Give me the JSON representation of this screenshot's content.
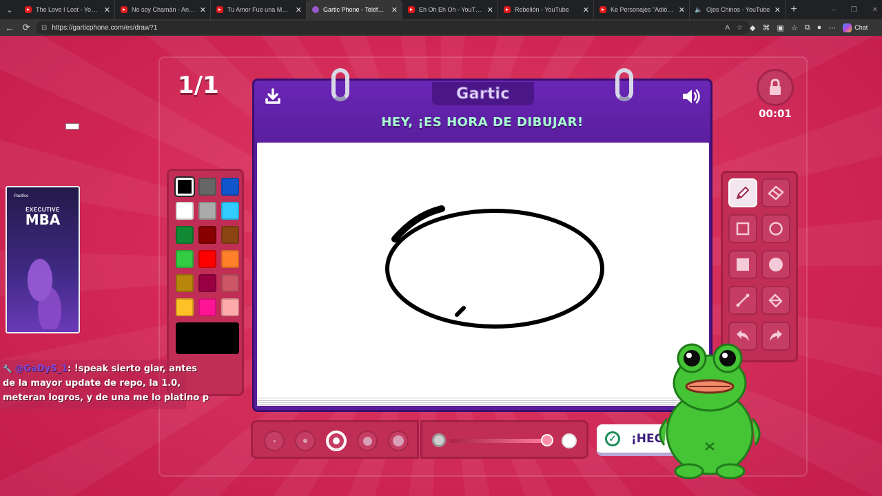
{
  "browser": {
    "tabs": [
      {
        "title": "The Love I Lost - YouTube",
        "icon": "youtube-icon",
        "active": false
      },
      {
        "title": "No soy Chamán - Anticucho",
        "icon": "youtube-icon",
        "active": false
      },
      {
        "title": "Tu Amor Fue una Mentira -",
        "icon": "youtube-icon",
        "active": false
      },
      {
        "title": "Gartic Phone - Teléfono Des",
        "icon": "gartic-icon",
        "active": true
      },
      {
        "title": "Eh Oh Eh Oh - YouTube",
        "icon": "youtube-icon",
        "active": false
      },
      {
        "title": "Rebelión - YouTube",
        "icon": "youtube-icon",
        "active": false
      },
      {
        "title": "Ke Personajes \"Adiós Amor #",
        "icon": "youtube-icon",
        "active": false
      },
      {
        "title": "Ojos Chinos - YouTube",
        "icon": "speaker-icon",
        "active": false
      }
    ],
    "url": "https://garticphone.com/es/draw?1",
    "chat_label": "Chat"
  },
  "game": {
    "round": "1/1",
    "logo": "Gartic",
    "prompt": "HEY, ¡ES HORA DE DIBUJAR!",
    "timer": "00:01",
    "done_label": "¡HEC",
    "palette": [
      "#000000",
      "#666666",
      "#1155cc",
      "#ffffff",
      "#aaaaaa",
      "#33ccff",
      "#118833",
      "#880000",
      "#8b4513",
      "#33cc44",
      "#ff0000",
      "#ff7f2a",
      "#b8860b",
      "#990044",
      "#cc5566",
      "#ffc125",
      "#ff1493",
      "#ffaaaa"
    ],
    "selected_color": "#000000",
    "tools": [
      "pencil-icon",
      "eraser-icon",
      "rectangle-outline-icon",
      "ellipse-outline-icon",
      "rectangle-filled-icon",
      "ellipse-filled-icon",
      "line-icon",
      "fill-bucket-icon",
      "undo-icon",
      "redo-icon"
    ],
    "selected_tool": "pencil-icon",
    "brush_sizes": [
      1,
      2,
      3,
      4,
      5
    ],
    "selected_brush_size": 3
  },
  "overlays": {
    "ad": {
      "brand": "Pacífico",
      "line1": "EXECUTIVE",
      "line2": "MBA"
    },
    "chat": {
      "user": "@GaDyS_1",
      "line1": ": !speak sierto giar, antes",
      "line2": "de la mayor update de repo, la 1.0,",
      "line3": "meteran logros, y de una me lo platino p"
    }
  }
}
